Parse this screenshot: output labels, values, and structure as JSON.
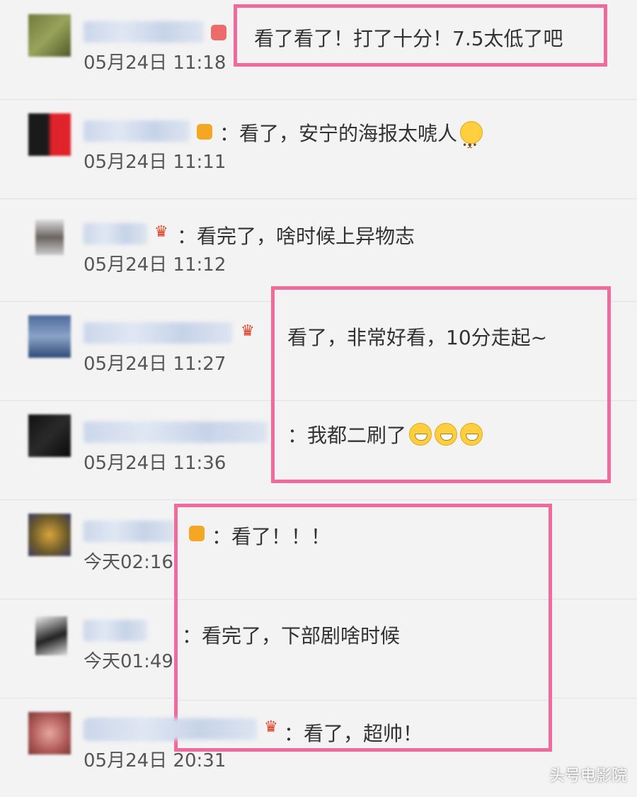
{
  "comments": [
    {
      "text": "：看了看了！打了十分！7.5太低了吧",
      "time": "05月24日 11:18"
    },
    {
      "text": "：看了，安宁的海报太唬人",
      "time": "05月24日 11:11",
      "emoji": "cat-emoji"
    },
    {
      "text": "：看完了，啥时候上异物志",
      "time": "05月24日 11:12"
    },
    {
      "text": "：看了，非常好看，10分走起~",
      "time": "05月24日 11:27"
    },
    {
      "text": "：我都二刷了",
      "time": "05月24日 11:36",
      "emoji": "grin-emoji"
    },
    {
      "text": "：看了！！！",
      "time": "今天02:16"
    },
    {
      "text": "：看完了，下部剧啥时候",
      "time": "今天01:49"
    },
    {
      "text": "：看了，超帅！",
      "time": "05月24日 20:31"
    }
  ],
  "highlight_text": {
    "box1": "看了看了！打了十分！7.5太低了吧",
    "box2_line1": "看了，非常好看，10分走起~",
    "box2_line2": "：我都二刷了",
    "box3_line1": "：看了！！！",
    "box3_line2": "：看完了，下部剧啥时候",
    "box3_line3": "：看了，超帅！"
  },
  "watermark": "头号电影院",
  "colors": {
    "highlight_border": "#f06b9c",
    "background": "#f3f3f3"
  }
}
